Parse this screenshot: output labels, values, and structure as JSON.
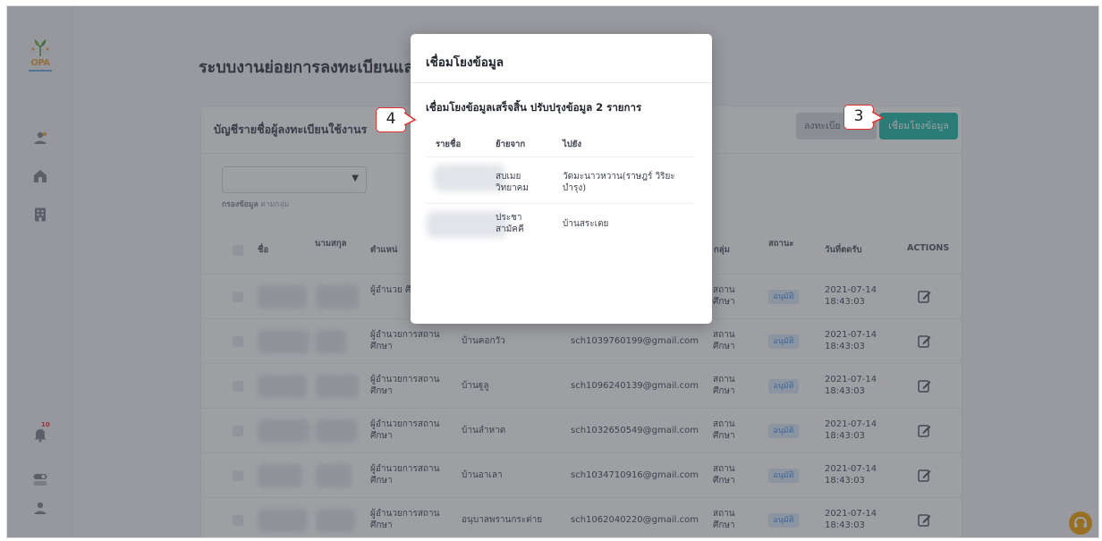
{
  "app": {
    "logo_text": "OPA",
    "notification_count": "10"
  },
  "header": {
    "title": "ระบบงานย่อยการลงทะเบียนแล"
  },
  "card": {
    "title": "บัญชีรายชื่อผู้ลงทะเบียนใช้งานร",
    "register_button": "ลงทะเบีย",
    "link_button": "เชื่อมโยงข้อมูล",
    "filter_hint_bold": "กรองข้อมูล",
    "filter_hint_rest": "ตามกลุ่ม"
  },
  "table": {
    "headers": {
      "name": "ชื่อ",
      "surname": "นามสกุล",
      "position": "ตำแหน่",
      "group": "กลุ่ม",
      "status": "สถานะ",
      "date": "วันที่ตดรับ",
      "actions": "ACTIONS"
    },
    "rows": [
      {
        "position": "ผู้อำนวย ศึกษา",
        "org": "",
        "email": "",
        "group": "สถาน ศึกษา",
        "status": "อนุมัติ",
        "date": "2021-07-14",
        "time": "18:43:03"
      },
      {
        "position": "ผู้อำนวยการสถาน ศึกษา",
        "org": "บ้านคอกวัว",
        "email": "sch1039760199@gmail.com",
        "group": "สถาน ศึกษา",
        "status": "อนุมัติ",
        "date": "2021-07-14",
        "time": "18:43:03"
      },
      {
        "position": "ผู้อำนวยการสถาน ศึกษา",
        "org": "บ้านฐูลู",
        "email": "sch1096240139@gmail.com",
        "group": "สถาน ศึกษา",
        "status": "อนุมัติ",
        "date": "2021-07-14",
        "time": "18:43:03"
      },
      {
        "position": "ผู้อำนวยการสถาน ศึกษา",
        "org": "บ้านลำหาด",
        "email": "sch1032650549@gmail.com",
        "group": "สถาน ศึกษา",
        "status": "อนุมัติ",
        "date": "2021-07-14",
        "time": "18:43:03"
      },
      {
        "position": "ผู้อำนวยการสถาน ศึกษา",
        "org": "บ้านอาเลา",
        "email": "sch1034710916@gmail.com",
        "group": "สถาน ศึกษา",
        "status": "อนุมัติ",
        "date": "2021-07-14",
        "time": "18:43:03"
      },
      {
        "position": "ผู้อำนวยการสถาน ศึกษา",
        "org": "อนุบาลพรานกระต่าย",
        "email": "sch1062040220@gmail.com",
        "group": "สถาน ศึกษา",
        "status": "อนุมัติ",
        "date": "2021-07-14",
        "time": "18:43:03"
      }
    ]
  },
  "modal": {
    "title": "เชื่อมโยงข้อมูล",
    "message": "เชื่อมโยงข้อมูลเสร็จสิ้น ปรับปรุงข้อมูล 2 รายการ",
    "headers": {
      "name": "รายชื่อ",
      "from": "ย้ายจาก",
      "to": "ไปยัง"
    },
    "rows": [
      {
        "from": "สบเมย วิทยาคม",
        "to": "วัดมะนาวหวาน(ราษฎร์ วิริยะบำรุง)"
      },
      {
        "from": "ประชา สามัคคี",
        "to": "บ้านสระเตย"
      }
    ]
  },
  "callouts": {
    "step4": "4",
    "step3": "3"
  }
}
